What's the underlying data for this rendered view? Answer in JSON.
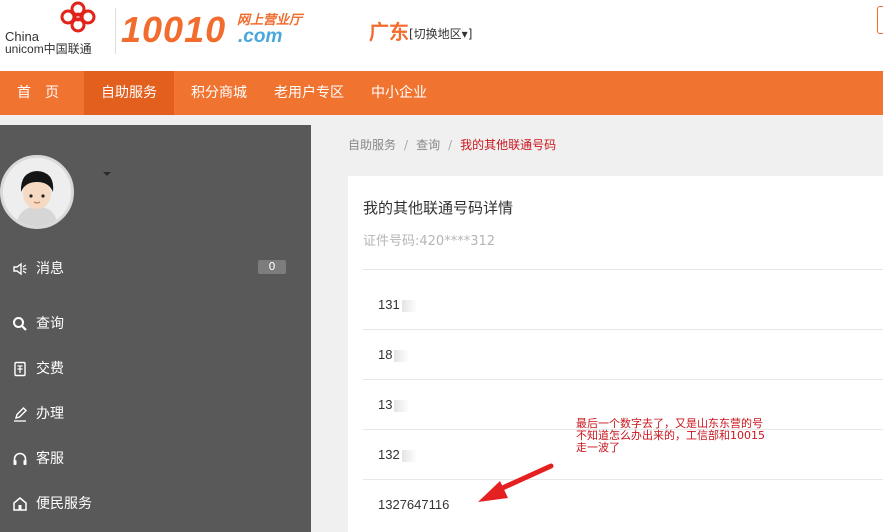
{
  "header": {
    "logo_line1": "China",
    "logo_line2": "unicom中国联通",
    "brand_number": "10010",
    "brand_cn": "网上营业厅",
    "brand_com": ".com",
    "region": "广东",
    "region_switch": "[切换地区▾]"
  },
  "nav": {
    "items": [
      {
        "label": "首　页"
      },
      {
        "label": "自助服务"
      },
      {
        "label": "积分商城"
      },
      {
        "label": "老用户专区"
      },
      {
        "label": "中小企业"
      }
    ]
  },
  "sidebar": {
    "items": [
      {
        "label": "消息",
        "icon": "speaker-icon"
      },
      {
        "label": "查询",
        "icon": "search-icon"
      },
      {
        "label": "交费",
        "icon": "receipt-icon"
      },
      {
        "label": "办理",
        "icon": "pencil-icon"
      },
      {
        "label": "客服",
        "icon": "headset-icon"
      },
      {
        "label": "便民服务",
        "icon": "home-icon"
      }
    ],
    "message_count": "0"
  },
  "breadcrumb": {
    "items": [
      "自助服务",
      "查询",
      "我的其他联通号码"
    ],
    "separator": "/"
  },
  "card": {
    "title": "我的其他联通号码详情",
    "id_label": "证件号码:420****312"
  },
  "numbers": [
    {
      "value": "131"
    },
    {
      "value": "18"
    },
    {
      "value": "13"
    },
    {
      "value": "132"
    },
    {
      "value": "1327647116"
    }
  ],
  "annotation": {
    "line1": "最后一个数字去了，又是山东东营的号",
    "line2": "不知道怎么办出来的，工信部和10015",
    "line3": "走一波了"
  },
  "colors": {
    "brand_orange": "#f26c2e",
    "nav_bg": "#f07330",
    "nav_active": "#e35f1e",
    "sidebar_bg": "#595959",
    "accent_red": "#c9161d"
  }
}
